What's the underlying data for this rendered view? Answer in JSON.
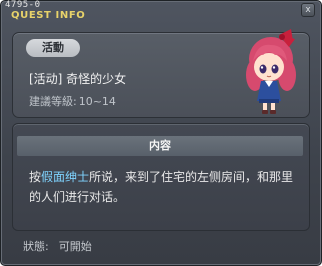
{
  "window": {
    "id_label": "4795-0",
    "title": "QUEST INFO",
    "close_label": "x"
  },
  "quest": {
    "tag": "活動",
    "name": "[活动] 奇怪的少女",
    "level_label": "建議等級:",
    "level_value": "10~14",
    "avatar_icon": "girl-npc-portrait"
  },
  "content": {
    "header": "内容",
    "text_prefix": "按",
    "text_highlight": "假面绅士",
    "text_suffix": "所说，来到了住宅的左侧房间，和那里的人们进行对话。"
  },
  "status": {
    "label": "狀態:",
    "value": "可開始"
  },
  "colors": {
    "title": "#e8d36a",
    "highlight": "#7fd4ff",
    "window_bg": "#444953"
  }
}
